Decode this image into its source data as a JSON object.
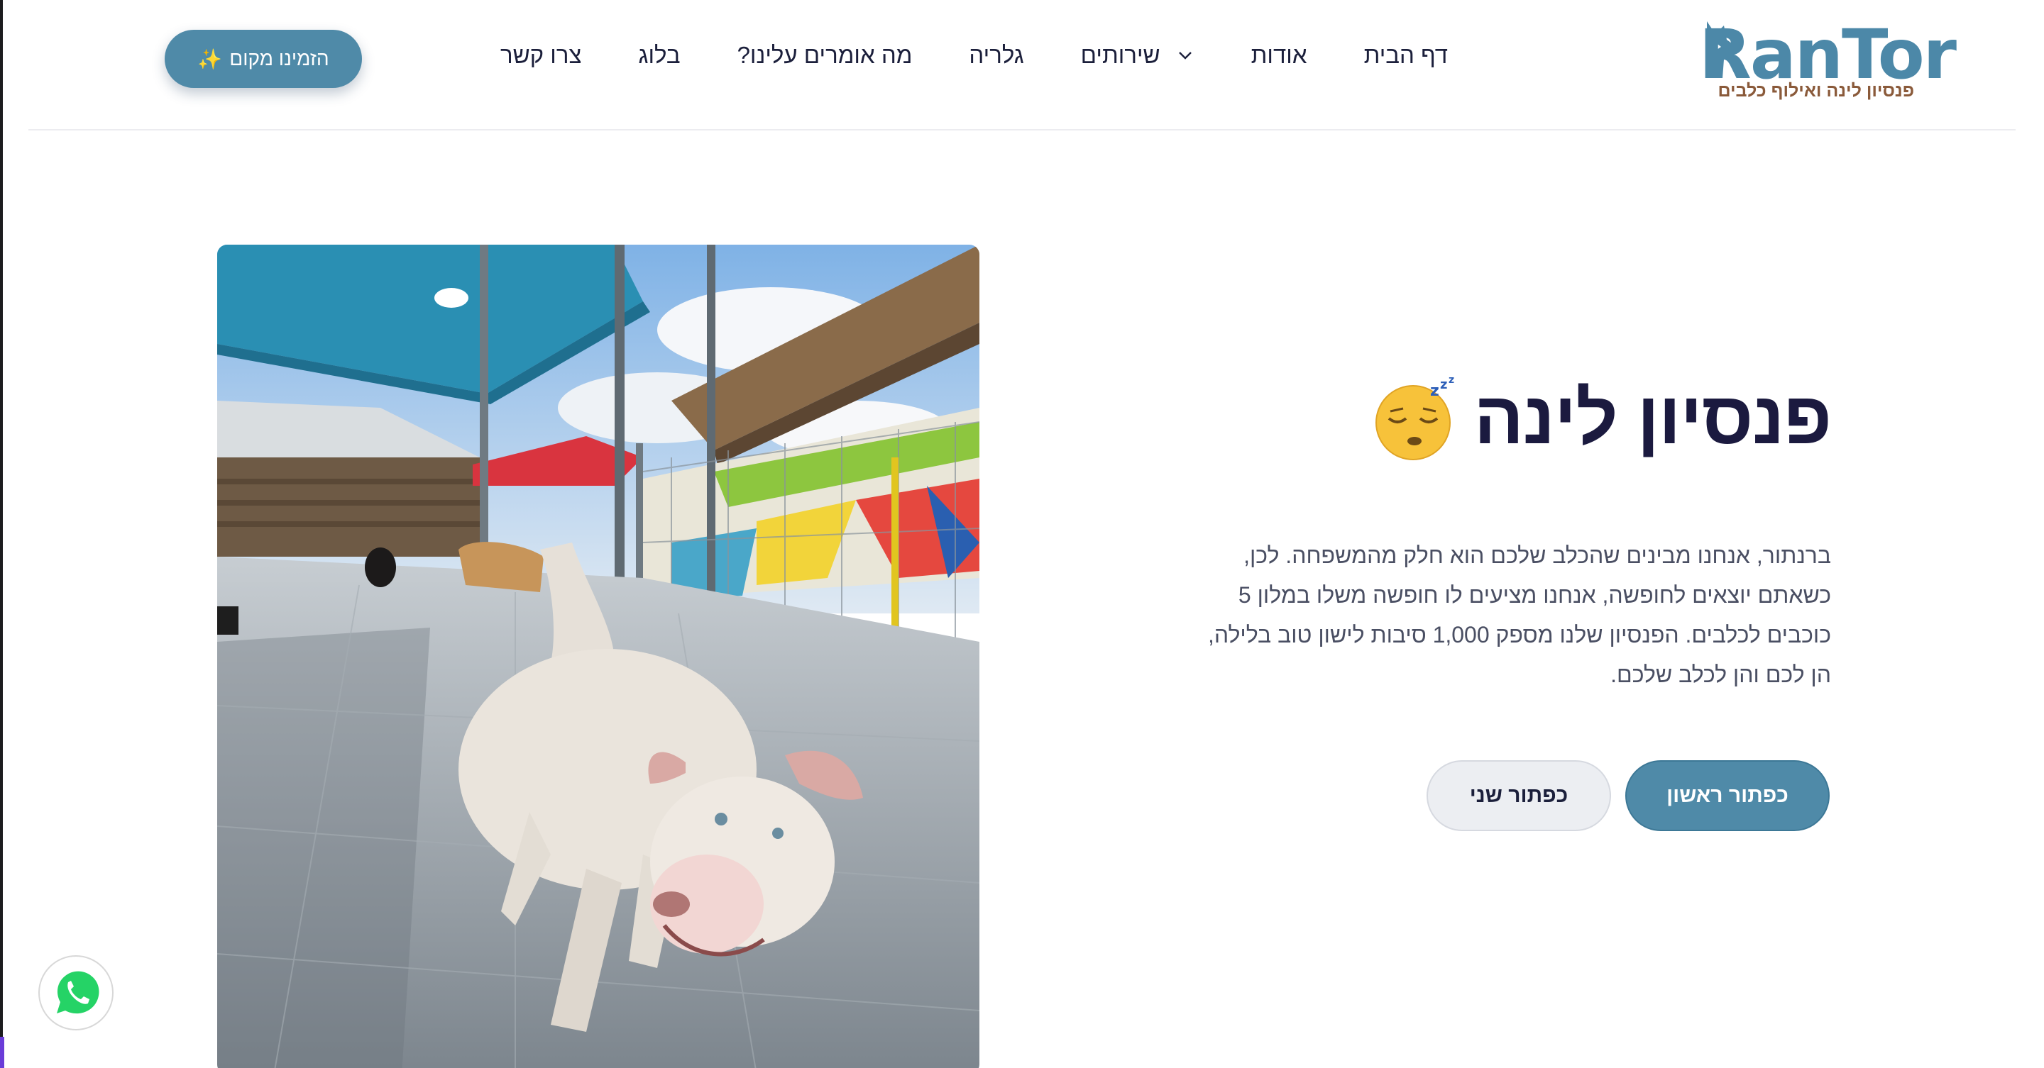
{
  "brand": {
    "name": "RanTor",
    "tagline": "פנסיון לינה ואילוף כלבים",
    "colors": {
      "primary": "#4f8aa8",
      "title": "#1b1a3f",
      "logo_sub": "#8a5a3a"
    }
  },
  "nav": {
    "items": [
      {
        "label": "דף הבית"
      },
      {
        "label": "אודות"
      },
      {
        "label": "שירותים",
        "has_dropdown": true
      },
      {
        "label": "גלריה"
      },
      {
        "label": "מה אומרים עלינו?"
      },
      {
        "label": "בלוג"
      },
      {
        "label": "צרו קשר"
      }
    ],
    "cta_label": "הזמינו מקום",
    "cta_icon": "sparkle-icon"
  },
  "hero": {
    "title": "פנסיון לינה",
    "title_emoji": "sleeping-face-emoji",
    "description": "ברנתור, אנחנו מבינים שהכלב שלכם הוא חלק מהמשפחה. לכן, כשאתם יוצאים לחופשה, אנחנו מציעים לו חופשה משלו במלון 5 כוכבים לכלבים. הפנסיון שלנו מספק 1,000 סיבות לישון טוב בלילה, הן לכם והן לכלב שלכם.",
    "primary_button": "כפתור ראשון",
    "secondary_button": "כפתור שני",
    "image_subject": "white dog in outdoor kennel yard"
  },
  "floating": {
    "whatsapp_icon": "whatsapp-icon"
  }
}
